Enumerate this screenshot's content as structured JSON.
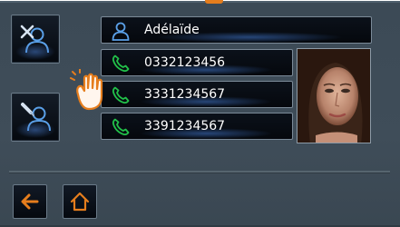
{
  "contact": {
    "name": "Adélaïde",
    "numbers": [
      {
        "value": "0332123456",
        "icon": "phone-icon"
      },
      {
        "value": "3331234567",
        "icon": "phone-icon"
      },
      {
        "value": "3391234567",
        "icon": "phone-icon"
      }
    ],
    "name_icon": "person-icon",
    "photo": "contact-photo"
  },
  "sidebar": {
    "delete_contact_icon": "delete-contact-icon",
    "edit_contact_icon": "edit-contact-icon"
  },
  "nav": {
    "back_icon": "back-arrow-icon",
    "home_icon": "home-icon"
  },
  "colors": {
    "accent": "#e57d1d",
    "phone_icon": "#22c24a",
    "person_icon": "#5aa0e8",
    "panel": "#3f4d59"
  }
}
